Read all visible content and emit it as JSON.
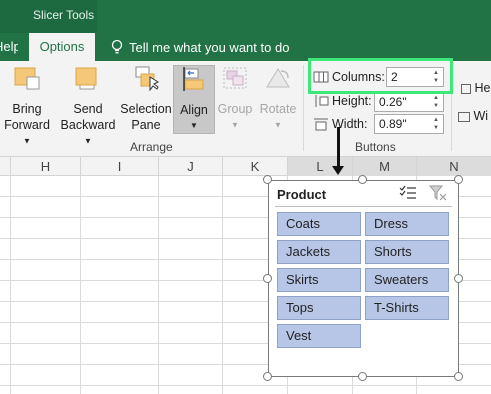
{
  "title_bar": {
    "context_label": "Slicer Tools"
  },
  "tabs": {
    "help": "Help",
    "options": "Options",
    "tell_me": "Tell me what you want to do"
  },
  "ribbon": {
    "arrange": {
      "bring_forward": [
        "Bring",
        "Forward"
      ],
      "send_backward": [
        "Send",
        "Backward"
      ],
      "selection_pane": [
        "Selection",
        "Pane"
      ],
      "align": "Align",
      "group": "Group",
      "rotate": "Rotate",
      "label": "Arrange"
    },
    "buttons": {
      "columns_label": "Columns:",
      "columns_value": "2",
      "height_label": "Height:",
      "height_value": "0.26\"",
      "width_label": "Width:",
      "width_value": "0.89\"",
      "label": "Buttons"
    },
    "size_cut": {
      "height_fragment": "He",
      "width_fragment": "Wi"
    }
  },
  "grid": {
    "columns": [
      "H",
      "I",
      "J",
      "K",
      "L",
      "M",
      "N"
    ]
  },
  "slicer": {
    "title": "Product",
    "items": [
      "Coats",
      "Dress",
      "Jackets",
      "Shorts",
      "Skirts",
      "Sweaters",
      "Tops",
      "T-Shirts",
      "Vest"
    ]
  },
  "colors": {
    "excel_green": "#217346",
    "highlight": "#3ee878",
    "slicer_item": "#b7c6e6"
  }
}
